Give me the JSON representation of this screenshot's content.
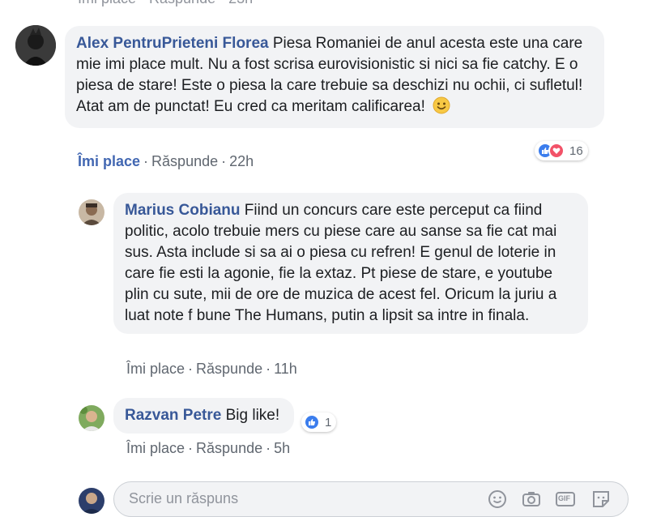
{
  "top_partial": {
    "text": "Îmi place · Răspunde · 23h"
  },
  "comments": [
    {
      "author": "Alex PentruPrieteni Florea",
      "text": "Piesa Romaniei de anul acesta este una care mie imi place mult. Nu a fost scrisa eurovisionistic si nici sa fie catchy. E o piesa de stare! Este o piesa la care trebuie sa deschizi nu ochii, ci sufletul! Atat am de punctat! Eu cred ca meritam calificarea!",
      "emoji": "slightly-smiling-face",
      "like_label": "Îmi place",
      "reply_label": "Răspunde",
      "time": "22h",
      "reaction_count": "16",
      "reactions": [
        "like-icon",
        "love-icon"
      ],
      "liked": true
    },
    {
      "author": "Marius Cobianu",
      "text": "Fiind un concurs care este perceput ca fiind politic, acolo trebuie mers cu piese care au sanse sa fie cat mai sus. Asta include si sa ai o piesa cu refren! E genul de loterie in care fie esti la agonie, fie la extaz. Pt piese de stare, e youtube plin cu sute, mii de ore de muzica de acest fel. Oricum la juriu a luat note f bune The Humans, putin a lipsit sa intre in finala.",
      "like_label": "Îmi place",
      "reply_label": "Răspunde",
      "time": "11h"
    },
    {
      "author": "Razvan Petre",
      "text": "Big like!",
      "like_label": "Îmi place",
      "reply_label": "Răspunde",
      "time": "5h",
      "reaction_count": "1",
      "reactions": [
        "like-icon"
      ]
    }
  ],
  "reply_box": {
    "placeholder": "Scrie un răspuns",
    "tools": [
      "emoji-icon",
      "camera-icon",
      "gif-icon",
      "sticker-icon"
    ],
    "gif_label": "GIF"
  },
  "colors": {
    "author": "#385898",
    "bubble": "#f2f3f5",
    "meta": "#606770",
    "like_active": "#4267b2",
    "like_reaction": "#3b7ded",
    "love_reaction": "#f25268"
  }
}
